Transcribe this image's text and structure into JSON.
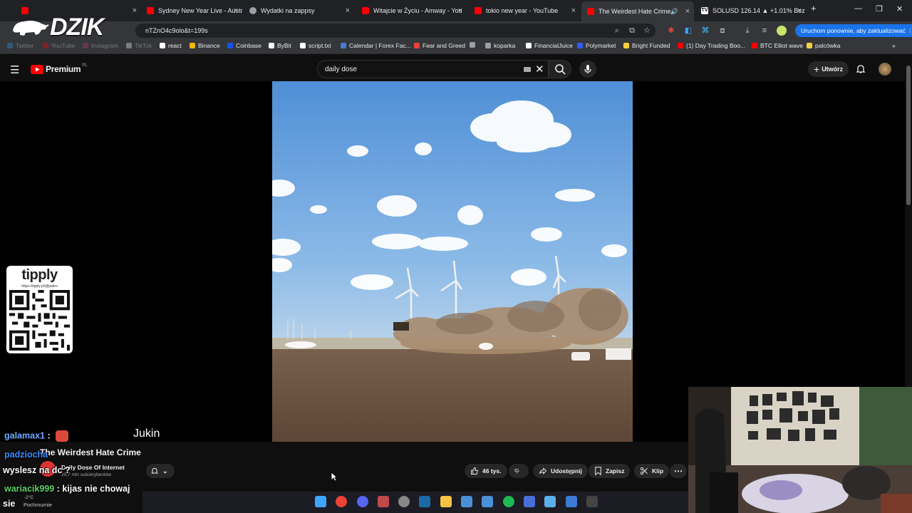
{
  "browser": {
    "tabs": [
      {
        "label": "",
        "color": "#ff0000",
        "active": false
      },
      {
        "label": "Sydney New Year Live - Australi",
        "color": "#ff0000",
        "active": false
      },
      {
        "label": "Wydatki na zappsy",
        "color": "#9aa0a6",
        "active": false
      },
      {
        "label": "Witajcie w Życiu - Amway - You",
        "color": "#ff0000",
        "active": false
      },
      {
        "label": "tokio new year - YouTube",
        "color": "#ff0000",
        "active": false
      },
      {
        "label": "The Weirdest Hate Crime",
        "color": "#ff0000",
        "active": true
      },
      {
        "label": "SOLUSD 126.14 ▲ +1.01% Bez",
        "color": "#ffffff",
        "active": false
      }
    ],
    "new_tab": "+",
    "url": "nTZnO4c9olo&t=199s",
    "update_button": "Uruchom ponownie, aby zaktualizować",
    "bookmarks": [
      {
        "label": "Twitter",
        "color": "#1da1f2"
      },
      {
        "label": "YouTube",
        "color": "#ff0000"
      },
      {
        "label": "Instagram",
        "color": "#c13584"
      },
      {
        "label": "TikTok",
        "color": "#ffffff"
      },
      {
        "label": "react",
        "color": "#ffffff"
      },
      {
        "label": "Binance",
        "color": "#f0b90b"
      },
      {
        "label": "Coinbase",
        "color": "#1652f0"
      },
      {
        "label": "ByBit",
        "color": "#ffffff"
      },
      {
        "label": "script.txt",
        "color": "#ffffff"
      },
      {
        "label": "Calendar | Forex Fac...",
        "color": "#4a7bd0"
      },
      {
        "label": "Fear and Greed",
        "color": "#ea4335"
      },
      {
        "label": "",
        "color": "#9aa0a6"
      },
      {
        "label": "koparka",
        "color": "#9aa0a6"
      },
      {
        "label": "FinancialJuice",
        "color": "#ffffff"
      },
      {
        "label": "Polymarket",
        "color": "#2e5cff"
      },
      {
        "label": "Bright Funded",
        "color": "#f5d142"
      },
      {
        "label": "(1) Day Trading Boo...",
        "color": "#ff0000"
      },
      {
        "label": "BTC Elliot wave",
        "color": "#ff0000"
      },
      {
        "label": "palcówka",
        "color": "#f5d142"
      }
    ]
  },
  "overlay": {
    "logo": "DZIK",
    "tipply_brand": "tipply",
    "tipply_url": "https://tipply.pl/@patiro",
    "jukin": "Jukin"
  },
  "youtube": {
    "premium_label": "Premium",
    "premium_region": "PL",
    "search_value": "daily dose",
    "create_label": "Utwórz",
    "video_title": "The Weirdest Hate Crime",
    "channel_name": "Daily Dose Of Internet",
    "subscribers": "20,7 mln subskrybentów",
    "likes": "46 tys.",
    "share_label": "Udostępnij",
    "save_label": "Zapisz",
    "clip_label": "Klip"
  },
  "chat": [
    {
      "user": "galamax1",
      "sep": " :",
      "msg": "",
      "color": "#6fa8ff"
    },
    {
      "user": "padziocha",
      "sep": "",
      "msg": "",
      "color": "#3d8bff"
    },
    {
      "user": "",
      "sep": "",
      "msg": "wyslesz na dc ?",
      "color": "#ffffff"
    },
    {
      "user": "wariacik999",
      "sep": " :",
      "msg": " kijas nie chowaj",
      "color": "#5fd068"
    },
    {
      "user": "",
      "sep": "",
      "msg": "sie",
      "color": "#ffffff"
    }
  ],
  "weather": {
    "temp": "-2°C",
    "desc": "Pochmurnie"
  },
  "taskbar": {
    "icons": [
      {
        "name": "windows-start-icon",
        "color": "#3fa7ff"
      },
      {
        "name": "chrome-icon",
        "color": "#ea4335"
      },
      {
        "name": "discord-icon",
        "color": "#5865f2"
      },
      {
        "name": "app-icon",
        "color": "#c04a4a"
      },
      {
        "name": "obs-icon",
        "color": "#888888"
      },
      {
        "name": "steam-icon",
        "color": "#1b6aa5"
      },
      {
        "name": "folder-icon",
        "color": "#f6c343"
      },
      {
        "name": "ccleaner-icon",
        "color": "#4a90d9"
      },
      {
        "name": "network-icon",
        "color": "#4a90d9"
      },
      {
        "name": "spotify-icon",
        "color": "#1db954"
      },
      {
        "name": "app2-icon",
        "color": "#4a6fd9"
      },
      {
        "name": "notepad-icon",
        "color": "#5ab0e8"
      },
      {
        "name": "photos-icon",
        "color": "#3a7bd5"
      },
      {
        "name": "terminal-icon",
        "color": "#444444"
      }
    ]
  }
}
